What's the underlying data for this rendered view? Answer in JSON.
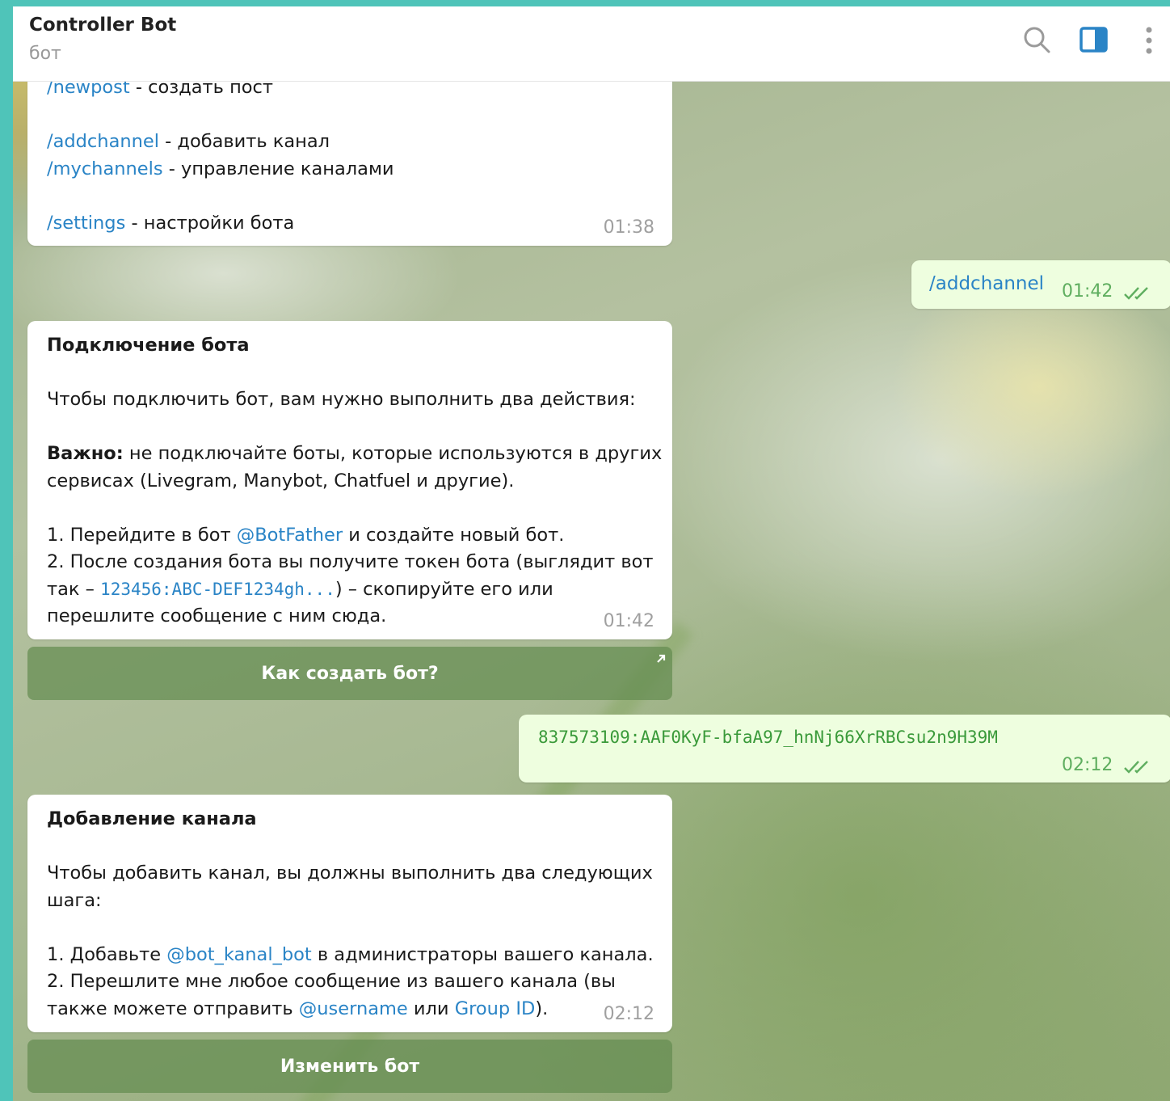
{
  "header": {
    "title": "Controller Bot",
    "subtitle": "бот",
    "icons": [
      "search-icon",
      "sidebar-toggle-icon",
      "more-vertical-icon"
    ]
  },
  "msg1": {
    "lines": [
      {
        "cmd": "/newpost",
        "text": " - создать пост"
      },
      {
        "cmd": "/addchannel",
        "text": " - добавить канал"
      },
      {
        "cmd": "/mychannels",
        "text": " - управление каналами"
      },
      {
        "cmd": "/settings",
        "text": " - настройки бота"
      }
    ],
    "time": "01:38"
  },
  "out1": {
    "text": "/addchannel",
    "time": "01:42"
  },
  "msg2": {
    "heading": "Подключение бота",
    "intro": "Чтобы подключить бот, вам нужно выполнить два действия:",
    "important_label": "Важно:",
    "important_text1": " не подключайте боты, которые используются в других",
    "important_text2": "сервисах (Livegram, Manybot, Chatfuel и другие).",
    "step1_a": "1. Перейдите в бот ",
    "step1_link": "@BotFather",
    "step1_b": " и создайте новый бот.",
    "step2_a": "2. После создания бота вы получите токен бота (выглядит вот",
    "step2_b": "так – ",
    "step2_code": "123456:ABC-DEF1234gh...",
    "step2_c": ") – скопируйте его или",
    "step2_d": "перешлите сообщение с ним сюда.",
    "time": "01:42"
  },
  "button1": {
    "label": "Как создать бот?"
  },
  "out2": {
    "text": "837573109:AAF0KyF-bfaA97_hnNj66XrRBCsu2n9H39M",
    "time": "02:12"
  },
  "msg3": {
    "heading": "Добавление канала",
    "intro1": "Чтобы добавить канал, вы должны выполнить два следующих",
    "intro2": "шага:",
    "step1_a": "1. Добавьте ",
    "step1_link": "@bot_kanal_bot",
    "step1_b": " в администраторы вашего канала.",
    "step2_a": "2. Перешлите мне любое сообщение из вашего канала (вы",
    "step2_b": "также можете отправить ",
    "step2_link1": "@username",
    "step2_c": " или ",
    "step2_link2": "Group ID",
    "step2_d": ").",
    "time": "02:12"
  },
  "button2": {
    "label": "Изменить бот"
  }
}
